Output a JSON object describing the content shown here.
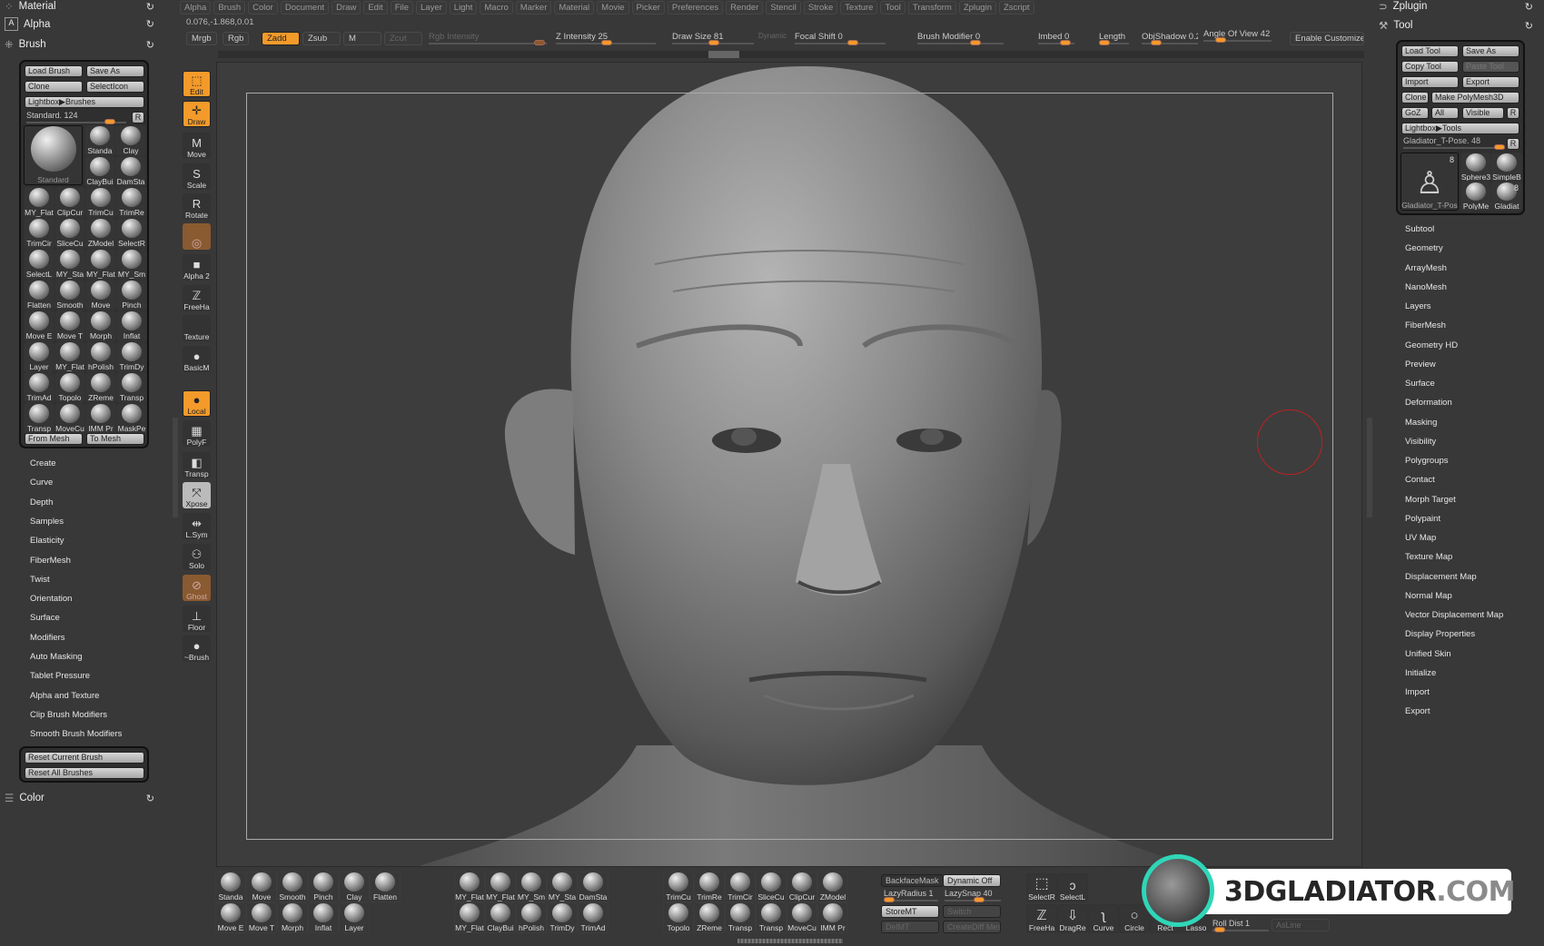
{
  "menu": [
    "Alpha",
    "Brush",
    "Color",
    "Document",
    "Draw",
    "Edit",
    "File",
    "Layer",
    "Light",
    "Macro",
    "Marker",
    "Material",
    "Movie",
    "Picker",
    "Preferences",
    "Render",
    "Stencil",
    "Stroke",
    "Texture",
    "Tool",
    "Transform",
    "Zplugin",
    "Zscript"
  ],
  "coords": "0.076,-1.868,0.01",
  "shelf": {
    "mrgb": "Mrgb",
    "rgb": "Rgb",
    "zadd": "Zadd",
    "zsub": "Zsub",
    "m": "M",
    "zcut": "Zcut",
    "rgb_intensity": "Rgb Intensity",
    "z_intensity": "Z Intensity 25",
    "draw_size": "Draw Size 81",
    "dynamic": "Dynamic",
    "focal_shift": "Focal Shift 0",
    "brush_modifier": "Brush Modifier 0",
    "imbed": "Imbed 0",
    "length": "Length",
    "objshadow": "ObjShadow 0.2",
    "angle_of_view": "Angle Of View 42",
    "enable_customize": "Enable Customize"
  },
  "left": {
    "material": "Material",
    "alpha": "Alpha",
    "brush": "Brush",
    "color": "Color",
    "load_brush": "Load Brush",
    "save_as": "Save As",
    "clone": "Clone",
    "select_icon": "SelectIcon",
    "lightbox": "Lightbox▶Brushes",
    "current": "Standard. 124",
    "r": "R",
    "big": "Standard",
    "top_small": [
      "Standa",
      "Clay",
      "ClayBui",
      "DamSta"
    ],
    "brushes": [
      "MY_Flat",
      "ClipCur",
      "TrimCu",
      "TrimRe",
      "TrimCir",
      "SliceCu",
      "ZModel",
      "SelectR",
      "SelectL",
      "MY_Sta",
      "MY_Flat",
      "MY_Sm",
      "Flatten",
      "Smooth",
      "Move",
      "Pinch",
      "Move E",
      "Move T",
      "Morph",
      "Inflat",
      "Layer",
      "MY_Flat",
      "hPolish",
      "TrimDy",
      "TrimAd",
      "Topolo",
      "ZReme",
      "Transp",
      "Transp",
      "MoveCu",
      "IMM Pr",
      "MaskPe"
    ],
    "from_mesh": "From Mesh",
    "to_mesh": "To Mesh",
    "subpalettes": [
      "Create",
      "Curve",
      "Depth",
      "Samples",
      "Elasticity",
      "FiberMesh",
      "Twist",
      "Orientation",
      "Surface",
      "Modifiers",
      "Auto Masking",
      "Tablet Pressure",
      "Alpha and Texture",
      "Clip Brush Modifiers",
      "Smooth Brush Modifiers"
    ],
    "reset_current": "Reset Current Brush",
    "reset_all": "Reset All Brushes"
  },
  "toolbar": [
    {
      "label": "Edit",
      "icon": "edit-icon",
      "glyph": "⬚",
      "style": "on"
    },
    {
      "label": "Draw",
      "icon": "draw-icon",
      "glyph": "✛",
      "style": "on"
    },
    {
      "label": "Move",
      "icon": "move-icon",
      "glyph": "M",
      "style": ""
    },
    {
      "label": "Scale",
      "icon": "scale-icon",
      "glyph": "S",
      "style": ""
    },
    {
      "label": "Rotate",
      "icon": "rotate-icon",
      "glyph": "R",
      "style": ""
    },
    {
      "label": "",
      "icon": "material-icon",
      "glyph": "◎",
      "style": "brown"
    },
    {
      "label": "Alpha 2",
      "icon": "alpha-icon",
      "glyph": "■",
      "style": ""
    },
    {
      "label": "FreeHa",
      "icon": "stroke-icon",
      "glyph": "ℤ",
      "style": ""
    },
    {
      "label": "Texture",
      "icon": "texture-icon",
      "glyph": "",
      "style": ""
    },
    {
      "label": "BasicM",
      "icon": "basic-material-icon",
      "glyph": "●",
      "style": ""
    },
    {
      "label": "Local",
      "icon": "local-icon",
      "glyph": "●",
      "style": "on"
    },
    {
      "label": "PolyF",
      "icon": "polyframe-icon",
      "glyph": "▦",
      "style": ""
    },
    {
      "label": "Transp",
      "icon": "transparency-icon",
      "glyph": "◧",
      "style": ""
    },
    {
      "label": "Xpose",
      "icon": "xpose-icon",
      "glyph": "⤧",
      "style": "light"
    },
    {
      "label": "L.Sym",
      "icon": "symmetry-icon",
      "glyph": "⇹",
      "style": ""
    },
    {
      "label": "Solo",
      "icon": "solo-icon",
      "glyph": "⚇",
      "style": ""
    },
    {
      "label": "Ghost",
      "icon": "ghost-icon",
      "glyph": "⊘",
      "style": "brown"
    },
    {
      "label": "Floor",
      "icon": "floor-icon",
      "glyph": "⊥",
      "style": ""
    },
    {
      "label": "~Brush",
      "icon": "brush-preview-icon",
      "glyph": "●",
      "style": ""
    }
  ],
  "right": {
    "zplugin": "Zplugin",
    "tool": "Tool",
    "load_tool": "Load Tool",
    "save_as": "Save As",
    "copy_tool": "Copy Tool",
    "paste_tool": "Paste Tool",
    "import": "Import",
    "export": "Export",
    "clone": "Clone",
    "make_polymesh": "Make PolyMesh3D",
    "goz": "GoZ",
    "all": "All",
    "visible": "Visible",
    "r": "R",
    "lightbox": "Lightbox▶Tools",
    "current": "Gladiator_T-Pose. 48",
    "big": "Gladiator_T-Pos",
    "big_count": "8",
    "tools": [
      {
        "label": "Sphere3",
        "count": ""
      },
      {
        "label": "SimpleB",
        "count": ""
      },
      {
        "label": "PolyMe",
        "count": ""
      },
      {
        "label": "Gladiat",
        "count": "8"
      }
    ],
    "subpalettes": [
      "Subtool",
      "Geometry",
      "ArrayMesh",
      "NanoMesh",
      "Layers",
      "FiberMesh",
      "Geometry HD",
      "Preview",
      "Surface",
      "Deformation",
      "Masking",
      "Visibility",
      "Polygroups",
      "Contact",
      "Morph Target",
      "Polypaint",
      "UV Map",
      "Texture Map",
      "Displacement Map",
      "Normal Map",
      "Vector Displacement Map",
      "Display Properties",
      "Unified Skin",
      "Initialize",
      "Import",
      "Export"
    ]
  },
  "bottom": {
    "group1": [
      "Standa",
      "Move E",
      "Move",
      "Move T",
      "Smooth",
      "Morph",
      "Pinch",
      "Inflat",
      "Clay",
      "Layer",
      "Flatten",
      ""
    ],
    "group2": [
      "MY_Flat",
      "MY_Flat",
      "MY_Flat",
      "ClayBui",
      "MY_Sm",
      "hPolish",
      "MY_Sta",
      "TrimDy",
      "DamSta",
      "TrimAd"
    ],
    "group3": [
      "TrimCu",
      "Topolo",
      "TrimRe",
      "ZReme",
      "TrimCir",
      "Transp",
      "SliceCu",
      "Transp",
      "ClipCur",
      "MoveCu",
      "ZModel",
      "IMM Pr"
    ],
    "backface": "BackfaceMask",
    "dynamic_off": "Dynamic Off",
    "lazy_radius": "LazyRadius 1",
    "lazy_snap": "LazySnap 40",
    "storemt": "StoreMT",
    "switch": "Switch",
    "delmt": "DelMT",
    "creatediff": "CreateDiff Mes",
    "selectr": "SelectR",
    "selectl": "SelectL",
    "strokes": [
      "FreeHa",
      "DragRe",
      "Curve",
      "Circle",
      "Rect",
      "Lasso"
    ],
    "roll_dist": "Roll Dist 1",
    "asline": "AsLine"
  },
  "watermark": {
    "main": "3DGLADIATOR",
    "suffix": ".COM"
  },
  "colors": {
    "accent": "#f39a2a",
    "panel": "#383838",
    "canvas": "#3d3d3d",
    "logo_ring": "#2fd6b8"
  }
}
